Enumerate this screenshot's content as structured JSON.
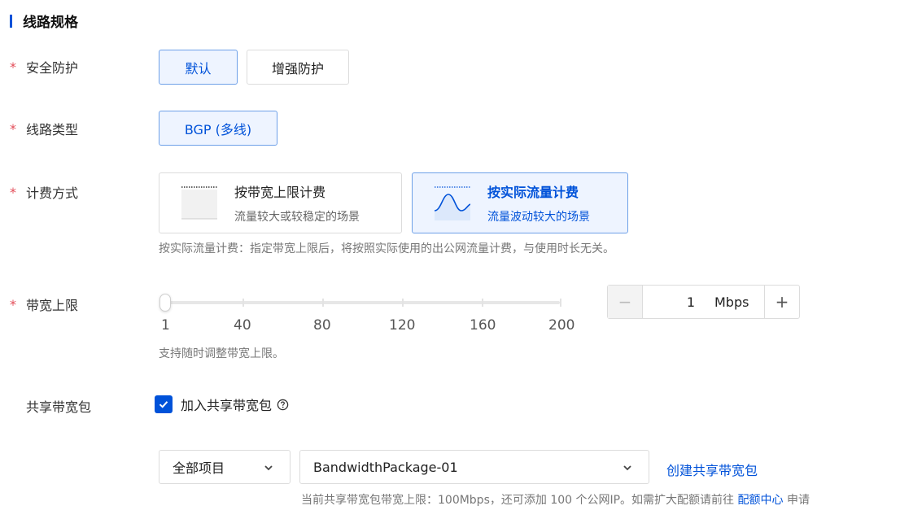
{
  "section": {
    "title": "线路规格"
  },
  "security": {
    "label": "安全防护",
    "options": [
      "默认",
      "增强防护"
    ],
    "selected": "默认"
  },
  "line_type": {
    "label": "线路类型",
    "options": [
      "BGP (多线)"
    ],
    "selected": "BGP (多线)"
  },
  "billing": {
    "label": "计费方式",
    "cards": [
      {
        "title": "按带宽上限计费",
        "desc": "流量较大或较稳定的场景",
        "icon": "bandwidth-cap-icon"
      },
      {
        "title": "按实际流量计费",
        "desc": "流量波动较大的场景",
        "icon": "traffic-wave-icon"
      }
    ],
    "selected": "按实际流量计费",
    "hint": "按实际流量计费：指定带宽上限后，将按照实际使用的出公网流量计费，与使用时长无关。"
  },
  "bandwidth": {
    "label": "带宽上限",
    "slider_labels": [
      "1",
      "40",
      "80",
      "120",
      "160",
      "200"
    ],
    "value": "1",
    "unit": "Mbps",
    "hint": "支持随时调整带宽上限。"
  },
  "shared_package": {
    "label": "共享带宽包",
    "checkbox_label": "加入共享带宽包",
    "checked": true,
    "project_select": "全部项目",
    "package_select": "BandwidthPackage-01",
    "create_link": "创建共享带宽包",
    "note_prefix": "当前共享带宽包带宽上限：100Mbps，还可添加 100 个公网IP。如需扩大配额请前往",
    "note_link": "配额中心",
    "note_suffix": "申请"
  },
  "colors": {
    "primary": "#0052d9",
    "required": "#e34d59",
    "active_bg": "#eef4ff"
  }
}
